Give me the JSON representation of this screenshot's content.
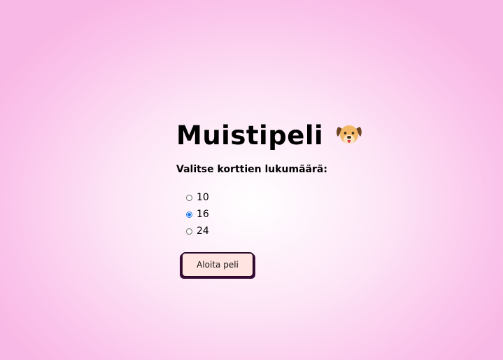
{
  "page": {
    "title": "Muistipeli",
    "title_icon": "dog-face-icon"
  },
  "form": {
    "prompt": "Valitse korttien lukumäärä:",
    "options": [
      {
        "label": "10",
        "selected": false
      },
      {
        "label": "16",
        "selected": true
      },
      {
        "label": "24",
        "selected": false
      }
    ],
    "start_label": "Aloita peli"
  },
  "colors": {
    "background_center": "#ffffff",
    "background_edge": "#f9b9e6",
    "button_fill": "#ffe4e1",
    "button_border": "#2a0a2a",
    "radio_accent": "#1a73e8"
  }
}
